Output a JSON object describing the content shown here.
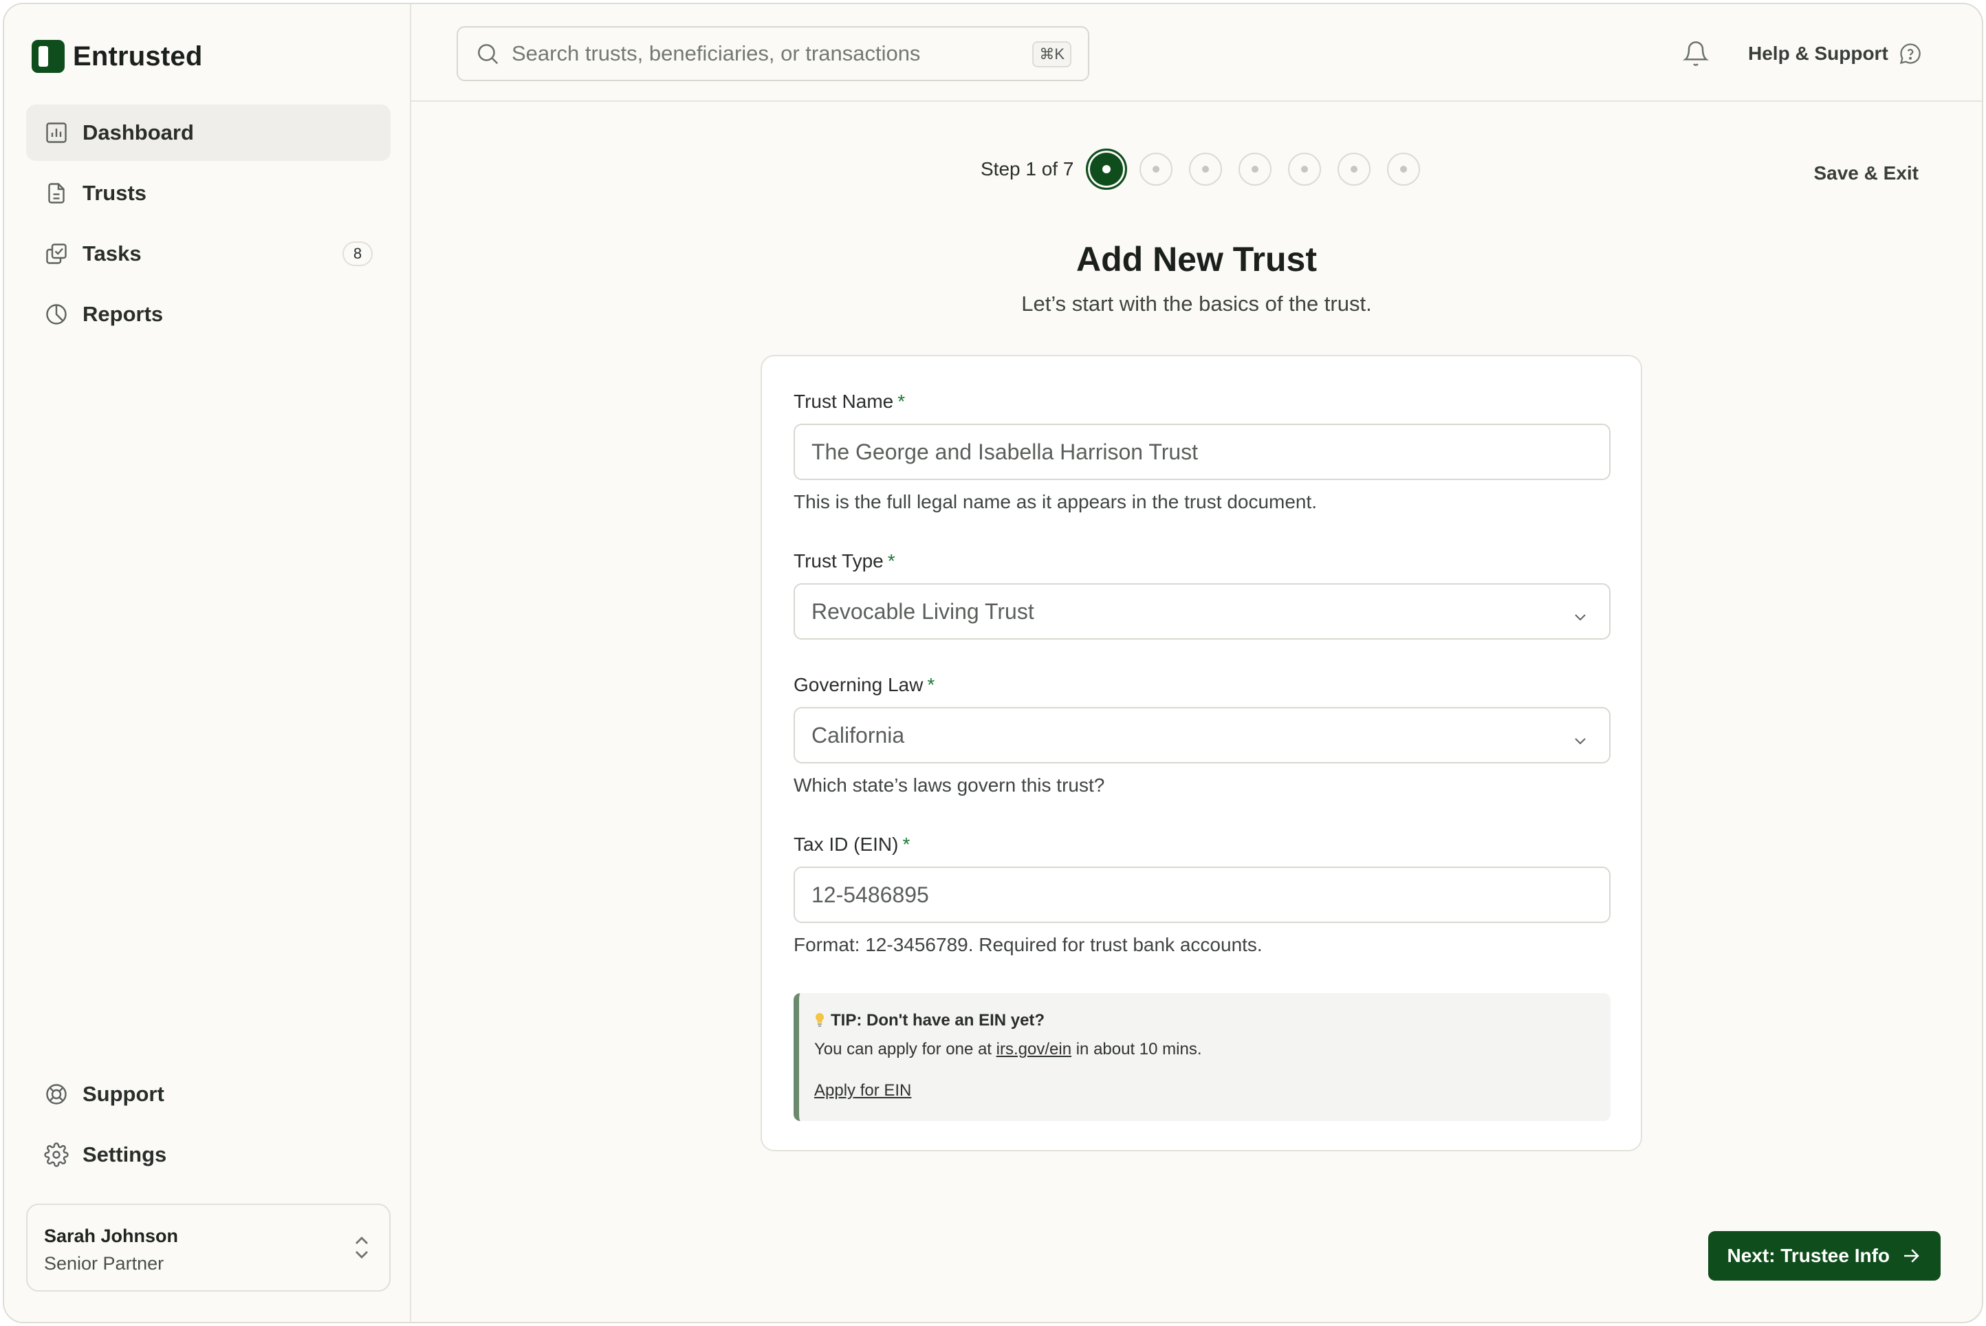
{
  "app": {
    "name": "Entrusted",
    "brand_color": "#0f4d1c"
  },
  "sidebar": {
    "items": [
      {
        "label": "Dashboard",
        "icon": "bar-chart-icon",
        "active": true
      },
      {
        "label": "Trusts",
        "icon": "document-icon"
      },
      {
        "label": "Tasks",
        "icon": "tasks-icon",
        "badge": "8"
      },
      {
        "label": "Reports",
        "icon": "pie-chart-icon"
      }
    ],
    "bottom_items": [
      {
        "label": "Support",
        "icon": "lifebuoy-icon"
      },
      {
        "label": "Settings",
        "icon": "gear-icon"
      }
    ],
    "user": {
      "name": "Sarah Johnson",
      "role": "Senior Partner"
    }
  },
  "header": {
    "search": {
      "placeholder": "Search trusts, beneficiaries, or transactions",
      "shortcut": "⌘K"
    },
    "help_label": "Help & Support"
  },
  "wizard": {
    "step_label": "Step 1 of 7",
    "current_step": 1,
    "total_steps": 7,
    "save_exit": "Save & Exit",
    "title": "Add New Trust",
    "subtitle": "Let’s start with the basics of the trust.",
    "fields": {
      "trust_name": {
        "label": "Trust Name",
        "required_mark": "*",
        "value": "The George and Isabella Harrison Trust",
        "hint": "This is the full legal name as it appears in the trust document."
      },
      "trust_type": {
        "label": "Trust Type",
        "required_mark": "*",
        "value": "Revocable Living Trust"
      },
      "governing_law": {
        "label": "Governing Law",
        "required_mark": "*",
        "value": "California",
        "hint": "Which state’s laws govern this trust?"
      },
      "tax_id": {
        "label": "Tax ID (EIN)",
        "required_mark": "*",
        "value": "12-5486895",
        "hint": "Format: 12-3456789. Required for trust bank accounts."
      }
    },
    "tip": {
      "title": "TIP: Don't have an EIN yet?",
      "body_prefix": "You can apply for one at ",
      "body_link": "irs.gov/ein",
      "body_suffix": " in about 10 mins.",
      "action": "Apply for EIN"
    },
    "next_button": "Next: Trustee Info"
  }
}
